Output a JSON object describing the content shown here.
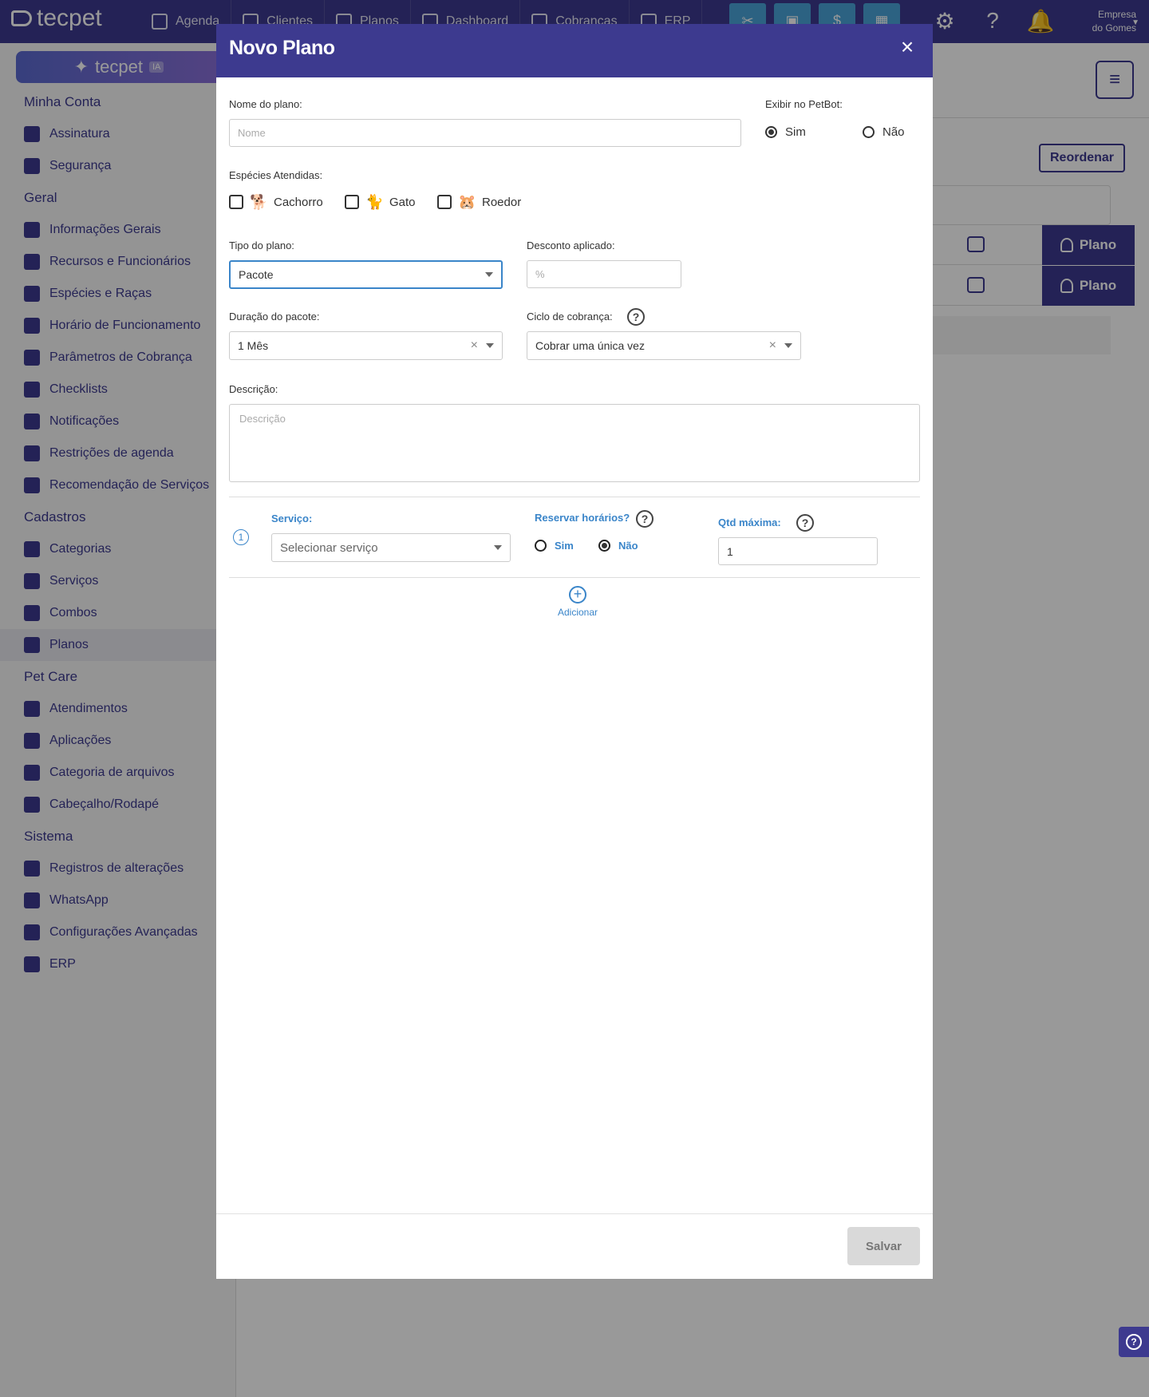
{
  "topbar": {
    "logo": "tecpet",
    "nav": [
      "Agenda",
      "Clientes",
      "Planos",
      "Dashboard",
      "Cobranças",
      "ERP"
    ],
    "company_line1": "Empresa",
    "company_line2": "do Gomes"
  },
  "sidebar": {
    "ia_label": "tecpet",
    "ia_badge": "IA",
    "sections": [
      {
        "title": "Minha Conta",
        "items": [
          "Assinatura",
          "Segurança"
        ]
      },
      {
        "title": "Geral",
        "items": [
          "Informações Gerais",
          "Recursos e Funcionários",
          "Espécies e Raças",
          "Horário de Funcionamento",
          "Parâmetros de Cobrança",
          "Checklists",
          "Notificações",
          "Restrições de agenda",
          "Recomendação de Serviços"
        ]
      },
      {
        "title": "Cadastros",
        "items": [
          "Categorias",
          "Serviços",
          "Combos",
          "Planos"
        ]
      },
      {
        "title": "Pet Care",
        "items": [
          "Atendimentos",
          "Aplicações",
          "Categoria de arquivos",
          "Cabeçalho/Rodapé"
        ]
      },
      {
        "title": "Sistema",
        "items": [
          "Registros de alterações",
          "WhatsApp",
          "Configurações Avançadas",
          "ERP"
        ]
      }
    ],
    "active": "Planos"
  },
  "main": {
    "reorder_label": "Reordenar",
    "rows": [
      {
        "button": "Plano"
      },
      {
        "button": "Plano"
      }
    ]
  },
  "modal": {
    "title": "Novo Plano",
    "close": "×",
    "name_label": "Nome do plano:",
    "name_placeholder": "Nome",
    "petbot_label": "Exibir no PetBot:",
    "petbot_yes": "Sim",
    "petbot_no": "Não",
    "species_label": "Espécies Atendidas:",
    "species": [
      "Cachorro",
      "Gato",
      "Roedor"
    ],
    "type_label": "Tipo do plano:",
    "type_value": "Pacote",
    "discount_label": "Desconto aplicado:",
    "discount_placeholder": "%",
    "duration_label": "Duração do pacote:",
    "duration_value": "1 Mês",
    "cycle_label": "Ciclo de cobrança:",
    "cycle_value": "Cobrar uma única vez",
    "desc_label": "Descrição:",
    "desc_placeholder": "Descrição",
    "service": {
      "step": "1",
      "label": "Serviço:",
      "placeholder": "Selecionar serviço",
      "reserve_label": "Reservar horários?",
      "reserve_yes": "Sim",
      "reserve_no": "Não",
      "qty_label": "Qtd máxima:",
      "qty_value": "1"
    },
    "add_label": "Adicionar",
    "save_label": "Salvar"
  },
  "colors": {
    "primary": "#3d3a8f",
    "accent": "#3a85c9",
    "quick": "#4aa3d9"
  }
}
